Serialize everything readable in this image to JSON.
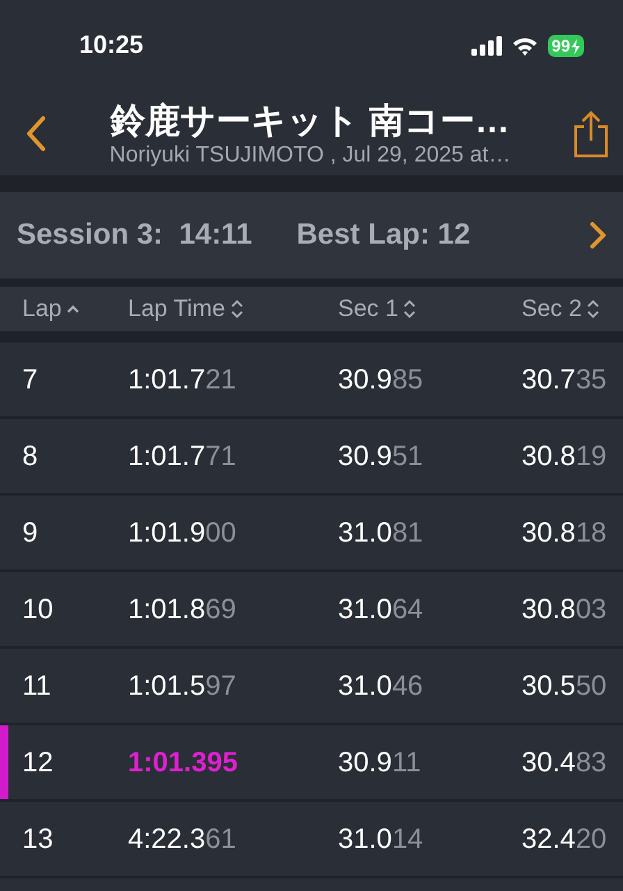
{
  "status_bar": {
    "time": "10:25",
    "battery": "99"
  },
  "header": {
    "title": "鈴鹿サーキット 南コー…",
    "subtitle": "Noriyuki TSUJIMOTO , Jul 29, 2025 at…"
  },
  "session_bar": {
    "session": "Session 3:  14:11",
    "best_lap": "Best Lap: 12"
  },
  "table": {
    "columns": [
      {
        "label": "Lap",
        "sorted": true
      },
      {
        "label": "Lap Time",
        "sorted": false
      },
      {
        "label": "Sec 1",
        "sorted": false
      },
      {
        "label": "Sec 2",
        "sorted": false
      }
    ],
    "rows": [
      {
        "best": false,
        "lap": "7",
        "lap_time": {
          "value": "1:01.7",
          "dim": "21"
        },
        "sec_1": {
          "value": "30.9",
          "dim": "85"
        },
        "sec_2": {
          "value": "30.7",
          "dim": "35"
        }
      },
      {
        "best": false,
        "lap": "8",
        "lap_time": {
          "value": "1:01.7",
          "dim": "71"
        },
        "sec_1": {
          "value": "30.9",
          "dim": "51"
        },
        "sec_2": {
          "value": "30.8",
          "dim": "19"
        }
      },
      {
        "best": false,
        "lap": "9",
        "lap_time": {
          "value": "1:01.9",
          "dim": "00"
        },
        "sec_1": {
          "value": "31.0",
          "dim": "81"
        },
        "sec_2": {
          "value": "30.8",
          "dim": "18"
        }
      },
      {
        "best": false,
        "lap": "10",
        "lap_time": {
          "value": "1:01.8",
          "dim": "69"
        },
        "sec_1": {
          "value": "31.0",
          "dim": "64"
        },
        "sec_2": {
          "value": "30.8",
          "dim": "03"
        }
      },
      {
        "best": false,
        "lap": "11",
        "lap_time": {
          "value": "1:01.5",
          "dim": "97"
        },
        "sec_1": {
          "value": "31.0",
          "dim": "46"
        },
        "sec_2": {
          "value": "30.5",
          "dim": "50"
        }
      },
      {
        "best": true,
        "lap": "12",
        "lap_time": {
          "value": "1:01.395"
        },
        "sec_1": {
          "value": "30.9",
          "dim": "11"
        },
        "sec_2": {
          "value": "30.4",
          "dim": "83"
        }
      },
      {
        "best": false,
        "lap": "13",
        "lap_time": {
          "value": "4:22.3",
          "dim": "61"
        },
        "sec_1": {
          "value": "31.0",
          "dim": "14"
        },
        "sec_2": {
          "value": "32.4",
          "dim": "20"
        }
      }
    ]
  }
}
